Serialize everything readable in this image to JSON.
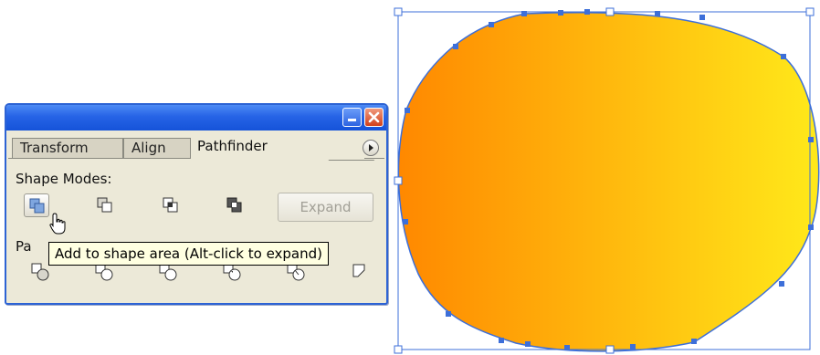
{
  "palette": {
    "title_buttons": {
      "minimize": "minimize-icon",
      "close": "close-icon"
    },
    "tabs": [
      {
        "label": "Transform",
        "active": false
      },
      {
        "label": "Align",
        "active": false
      },
      {
        "label": "Pathfinder",
        "active": true
      }
    ],
    "menu_icon": "palette-menu-icon",
    "shape_modes": {
      "label": "Shape Modes:",
      "buttons": [
        "add-to-shape-area-icon",
        "subtract-from-shape-area-icon",
        "intersect-shape-areas-icon",
        "exclude-overlapping-shape-areas-icon"
      ],
      "expand_label": "Expand"
    },
    "pathfinders": {
      "label": "Pa",
      "buttons": [
        "divide-icon",
        "trim-icon",
        "merge-icon",
        "crop-icon",
        "outline-icon",
        "minus-back-icon"
      ]
    },
    "tooltip": "Add to shape area (Alt-click to expand)"
  },
  "artwork": {
    "gradient": {
      "start": "#ff8800",
      "end": "#ffe91a"
    },
    "selection_color": "#3d6fd9"
  },
  "colors": {
    "title_bar": "#2663e6",
    "panel_bg": "#ece9d8",
    "tooltip_bg": "#ffffe1"
  }
}
